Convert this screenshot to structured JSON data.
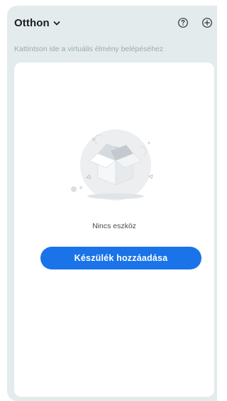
{
  "header": {
    "home_name": "Otthon",
    "hint_text": "Kattintson ide a virtuális élmény belépéséhez"
  },
  "icons": {
    "chevron": "chevron-down-icon",
    "help": "help-circle-icon",
    "add": "add-circle-icon",
    "empty": "open-box-icon"
  },
  "empty_state": {
    "message": "Nincs eszköz",
    "button_label": "Készülék hozzáadása"
  },
  "colors": {
    "accent": "#1a73e8",
    "background": "#e3ebed",
    "card": "#ffffff"
  }
}
